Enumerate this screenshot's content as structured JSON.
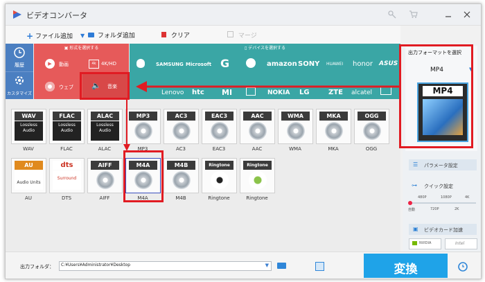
{
  "app": {
    "title": "ビデオコンバータ"
  },
  "toolbar": {
    "add_file": "ファイル追加",
    "add_folder": "フォルダ追加",
    "clear": "クリア",
    "merge": "マージ"
  },
  "format_panel": {
    "select_format_label": "形式を選択する",
    "select_device_label": "デバイスを選択する",
    "recent_label": "履歴",
    "custom_label": "カスタマイズ",
    "categories": {
      "video": "動画",
      "hd": "4K/HD",
      "web": "ウェブ",
      "audio": "音楽"
    },
    "device_brands": [
      "SAMSUNG",
      "Microsoft",
      "amazon",
      "SONY",
      "HUAWEI",
      "honor",
      "ASUS",
      "Lenovo",
      "htc",
      "MI",
      "NOKIA",
      "LG",
      "ZTE",
      "alcatel"
    ]
  },
  "audio_formats": [
    {
      "badge": "WAV",
      "label": "WAV",
      "sub": "Lossless Audio"
    },
    {
      "badge": "FLAC",
      "label": "FLAC",
      "sub": "Lossless Audio"
    },
    {
      "badge": "ALAC",
      "label": "ALAC",
      "sub": "Lossless Audio"
    },
    {
      "badge": "MP3",
      "label": "MP3"
    },
    {
      "badge": "AC3",
      "label": "AC3"
    },
    {
      "badge": "EAC3",
      "label": "EAC3"
    },
    {
      "badge": "AAC",
      "label": "AAC"
    },
    {
      "badge": "WMA",
      "label": "WMA"
    },
    {
      "badge": "MKA",
      "label": "MKA"
    },
    {
      "badge": "OGG",
      "label": "OGG"
    },
    {
      "badge": "AU",
      "label": "AU",
      "sub": "Audio Units"
    },
    {
      "badge": "dts",
      "label": "DTS",
      "sub": "Surround"
    },
    {
      "badge": "AIFF",
      "label": "AIFF"
    },
    {
      "badge": "M4A",
      "label": "M4A"
    },
    {
      "badge": "M4B",
      "label": "M4B"
    },
    {
      "badge": "Ringtone",
      "label": "Ringtone"
    },
    {
      "badge": "Ringtone",
      "label": "Ringtone"
    }
  ],
  "output": {
    "title": "出力フォーマットを選択",
    "selected_format": "MP4",
    "preview_badge": "MP4",
    "param_settings": "パラメータ設定",
    "quick_settings": "クイック設定",
    "quality_top": [
      "480P",
      "1080P",
      "4K"
    ],
    "quality_bottom": [
      "自動",
      "720P",
      "2K"
    ],
    "gpu_accel": "ビデオカード加速",
    "nvidia": "NVIDIA",
    "intel": "Intel"
  },
  "bottom": {
    "output_folder_label": "出力フォルダ：",
    "output_path": "C:¥Users¥Administrator¥Desktop",
    "convert": "変換"
  },
  "colors": {
    "accent_red": "#e11b22",
    "convert_blue": "#1fa3e8",
    "panel_teal": "#3aa6a5",
    "cat_red": "#e65a5a",
    "left_blue": "#4b7fc1"
  }
}
